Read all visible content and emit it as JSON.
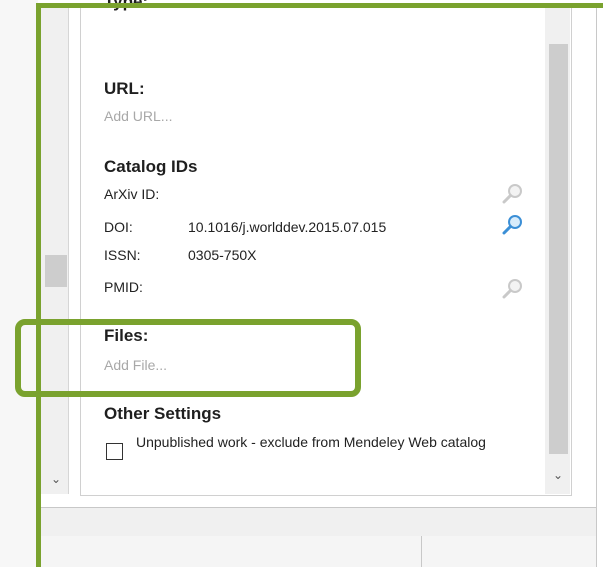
{
  "details": {
    "type_heading": "Type:",
    "url": {
      "heading": "URL:",
      "add_placeholder": "Add URL..."
    },
    "catalog": {
      "heading": "Catalog IDs",
      "arxiv_label": "ArXiv ID:",
      "doi_label": "DOI:",
      "doi_value": "10.1016/j.worlddev.2015.07.015",
      "issn_label": "ISSN:",
      "issn_value": "0305-750X",
      "pmid_label": "PMID:"
    },
    "files": {
      "heading": "Files:",
      "add_placeholder": "Add File..."
    },
    "other_settings": {
      "heading": "Other Settings",
      "unpublished_label": "Unpublished work - exclude from Mendeley Web catalog",
      "unpublished_checked": false
    }
  },
  "icons": {
    "lookup": "magnifier-icon",
    "scroll_down": "chevron-down-icon"
  },
  "colors": {
    "highlight": "#7aa22e",
    "placeholder": "#a8a8a8",
    "lookup_active": "#3b8fd6",
    "lookup_inactive": "#c9c9c9"
  }
}
